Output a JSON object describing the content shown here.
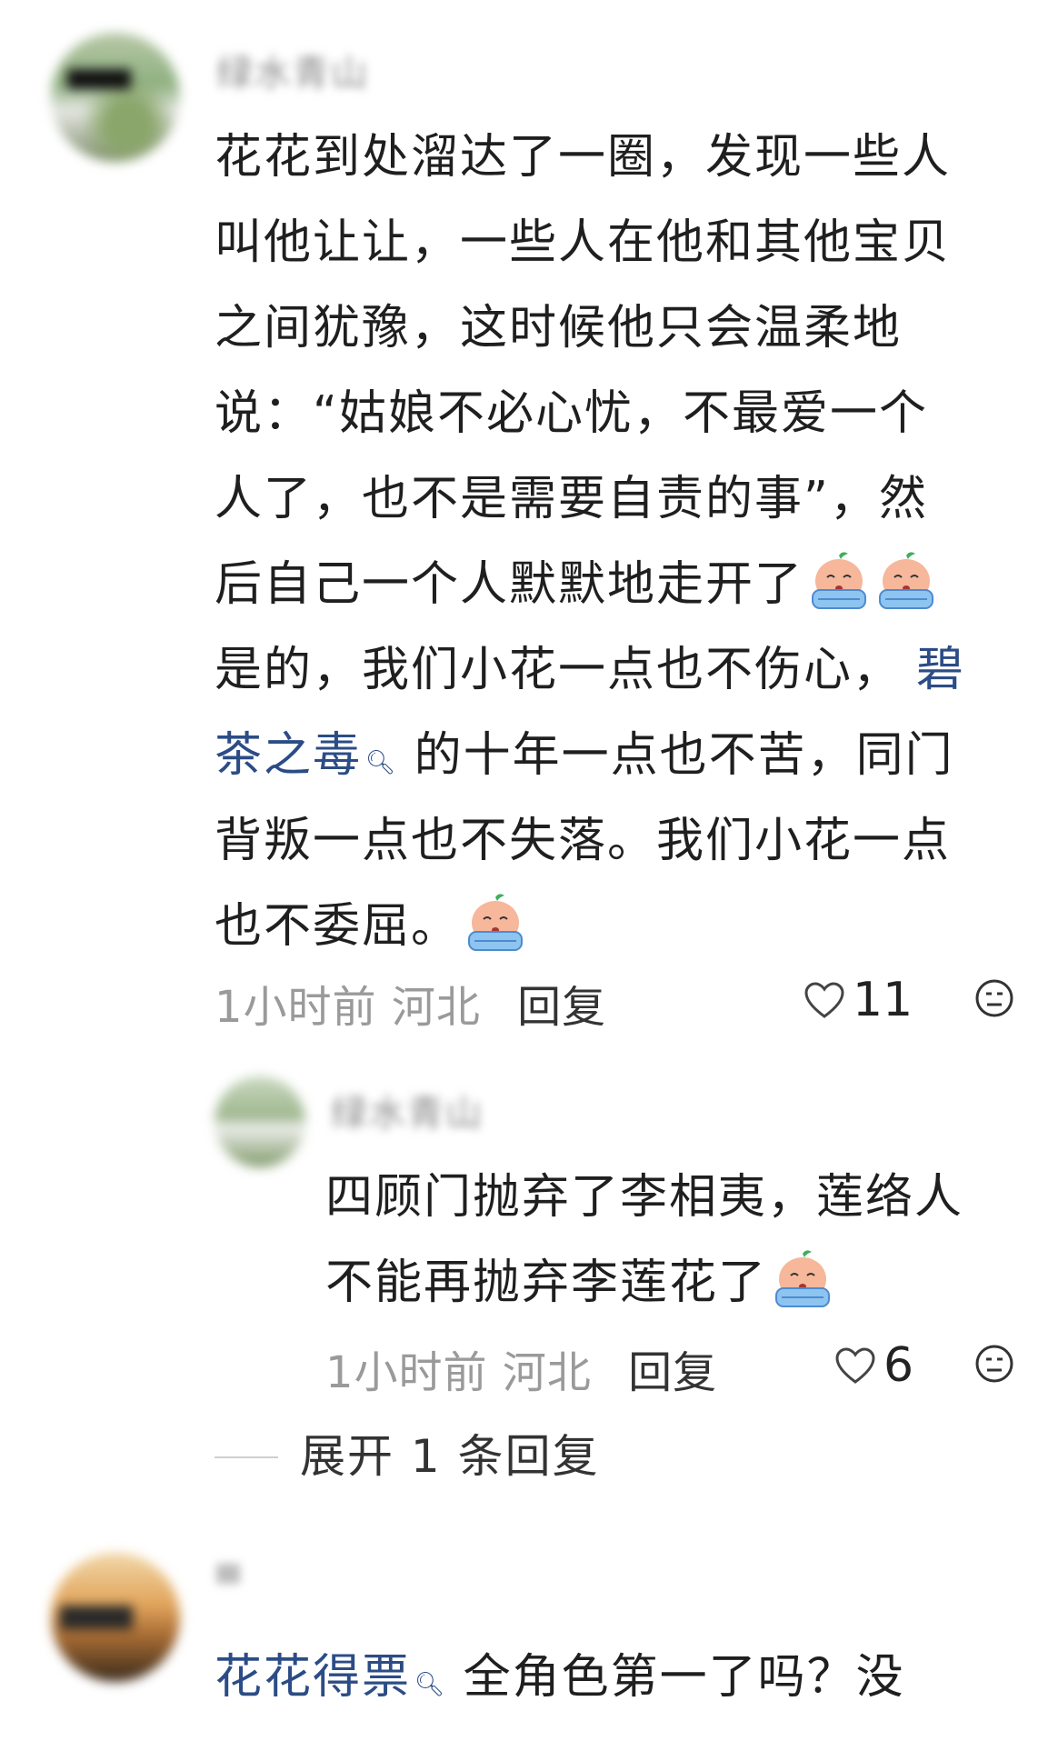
{
  "comments": [
    {
      "author": "绿水青山",
      "lines": [
        "花花到处溜达了一圈，发现一些人",
        "叫他让让，一些人在他和其他宝贝",
        "之间犹豫，这时候他只会温柔地",
        "说：“姑娘不必心忧，不最爱一个",
        "人了，也不是需要自责的事”，然",
        "后自己一个人默默地走开了"
      ],
      "line7_prefix": "是的，我们小花一点也不伤心，",
      "link_word": "碧",
      "line8_link": "茶之毒",
      "line8_rest": "的十年一点也不苦，同门",
      "line9": "背叛一点也不失落。我们小花一点",
      "line10": "也不委屈。",
      "time": "1小时前",
      "location": "河北",
      "reply_label": "回复",
      "likes": "11"
    },
    {
      "author": "绿水青山",
      "lines": [
        "四顾门抛弃了李相夷，莲络人",
        "不能再抛弃李莲花了"
      ],
      "time": "1小时前",
      "location": "河北",
      "reply_label": "回复",
      "likes": "6"
    }
  ],
  "expand_label": "展开 1 条回复",
  "third": {
    "link": "花花得票",
    "rest": "全角色第一了吗？没"
  },
  "icons": {
    "crying": "crying-peach-emoji",
    "like": "heart-outline-icon",
    "face": "neutral-face-icon",
    "search": "search-icon"
  }
}
